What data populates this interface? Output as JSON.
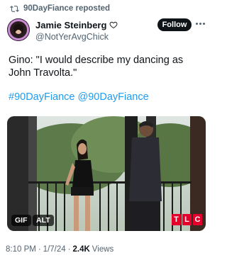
{
  "repost": {
    "icon": "repost-icon",
    "text": "90DayFiance reposted"
  },
  "author": {
    "display_name": "Jamie Steinberg",
    "badge_icon": "heart-outline-icon",
    "handle": "@NotYerAvgChick",
    "avatar_icon": "avatar"
  },
  "follow_label": "Follow",
  "more_icon": "more-options-icon",
  "tweet": {
    "text": "Gino: \"I would describe my dancing as John Travolta.\"",
    "hashtags": [
      "#90DayFiance",
      "@90DayFiance"
    ]
  },
  "media": {
    "gif_label": "GIF",
    "alt_label": "ALT",
    "network_logo": [
      "T",
      "L",
      "C"
    ],
    "logo_color": "#e4002b"
  },
  "meta": {
    "time": "8:10 PM",
    "separator": "·",
    "date": "1/7/24",
    "views_count": "2.4K",
    "views_label": "Views"
  },
  "colors": {
    "accent_link": "#1d9bf0",
    "text_primary": "#0f1419",
    "text_secondary": "#536471"
  }
}
